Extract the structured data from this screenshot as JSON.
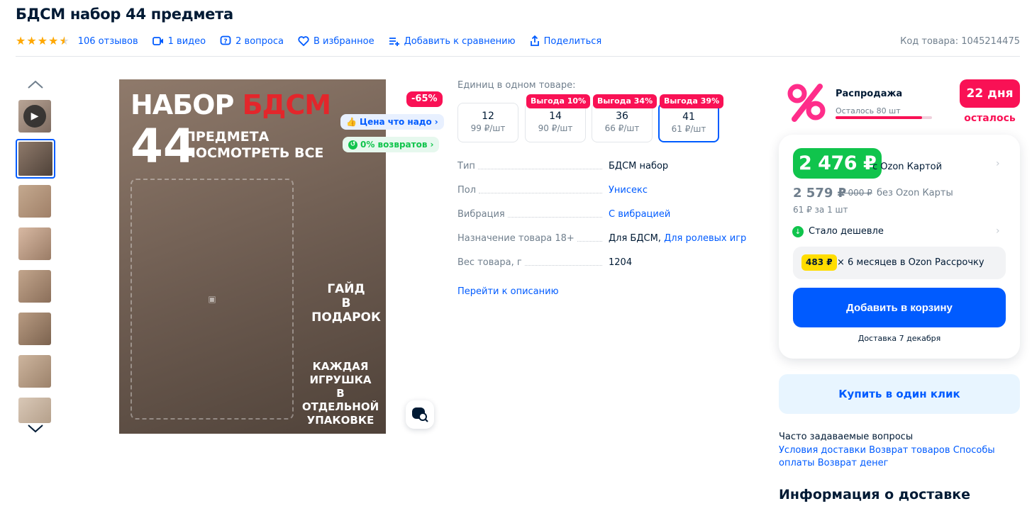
{
  "product": {
    "title": "БДСМ набор 44 предмета",
    "reviews": "106 отзывов",
    "videos": "1 видео",
    "questions": "2 вопроса",
    "favorite": "В избранное",
    "compare": "Добавить к сравнению",
    "share": "Поделиться",
    "sku": "Код товара: 1045214475",
    "rating": 4.5
  },
  "image": {
    "line1a": "НАБОР",
    "line1b": "БДСМ",
    "big_number": "44",
    "line2": "ПРЕДМЕТА\nПОСМОТРЕТЬ ВСЕ",
    "gift": "ГАЙД\nВ ПОДАРОК",
    "packaging": "КАЖДАЯ ИГРУШКА\nВ ОТДЕЛЬНОЙ\nУПАКОВКЕ",
    "discount": "-65%",
    "badge_price": "Цена что надо",
    "badge_returns": "0% возвратов"
  },
  "units": {
    "label": "Единиц в одном товаре:",
    "options": [
      {
        "qty": "12",
        "price": "99 ₽/шт",
        "tag": ""
      },
      {
        "qty": "14",
        "price": "90 ₽/шт",
        "tag": "Выгода 10%"
      },
      {
        "qty": "36",
        "price": "66 ₽/шт",
        "tag": "Выгода 34%"
      },
      {
        "qty": "41",
        "price": "61 ₽/шт",
        "tag": "Выгода 39%"
      }
    ],
    "selected_index": 3
  },
  "specs": [
    {
      "key": "Тип",
      "value": "БДСМ набор",
      "link": false
    },
    {
      "key": "Пол",
      "value": "Унисекс",
      "link": true
    },
    {
      "key": "Вибрация",
      "value": "С вибрацией",
      "link": true
    },
    {
      "key": "Назначение товара 18+",
      "value": "Для БДСМ,",
      "value2": "Для ролевых игр",
      "link": false
    },
    {
      "key": "Вес товара, г",
      "value": "1204",
      "link": false
    }
  ],
  "to_description": "Перейти к описанию",
  "sale": {
    "title": "Распродажа",
    "left": "Осталось 80 шт",
    "progress": 0.9,
    "days": "22 дня",
    "days_label": "осталось"
  },
  "price": {
    "card_price": "2 476 ₽",
    "card_label": "с Ozon Картой",
    "nocard_price": "2 579 ₽",
    "old_price": "7 000 ₽",
    "nocard_label": "без Ozon Карты",
    "per_unit": "61 ₽ за 1 шт",
    "cheaper": "Стало дешевле",
    "installment_amount": "483 ₽",
    "installment_text": "× 6 месяцев в Ozon Рассрочку",
    "add_to_cart": "Добавить в корзину",
    "delivery": "Доставка 7 декабря",
    "one_click": "Купить в один клик"
  },
  "faq": {
    "title": "Часто задаваемые вопросы",
    "links": [
      "Условия доставки",
      "Возврат товаров",
      "Способы оплаты",
      "Возврат денег"
    ]
  },
  "delivery_info": "Информация о доставке",
  "colors": {
    "accent": "#005bff",
    "sale": "#f91155",
    "green": "#10c44c"
  }
}
